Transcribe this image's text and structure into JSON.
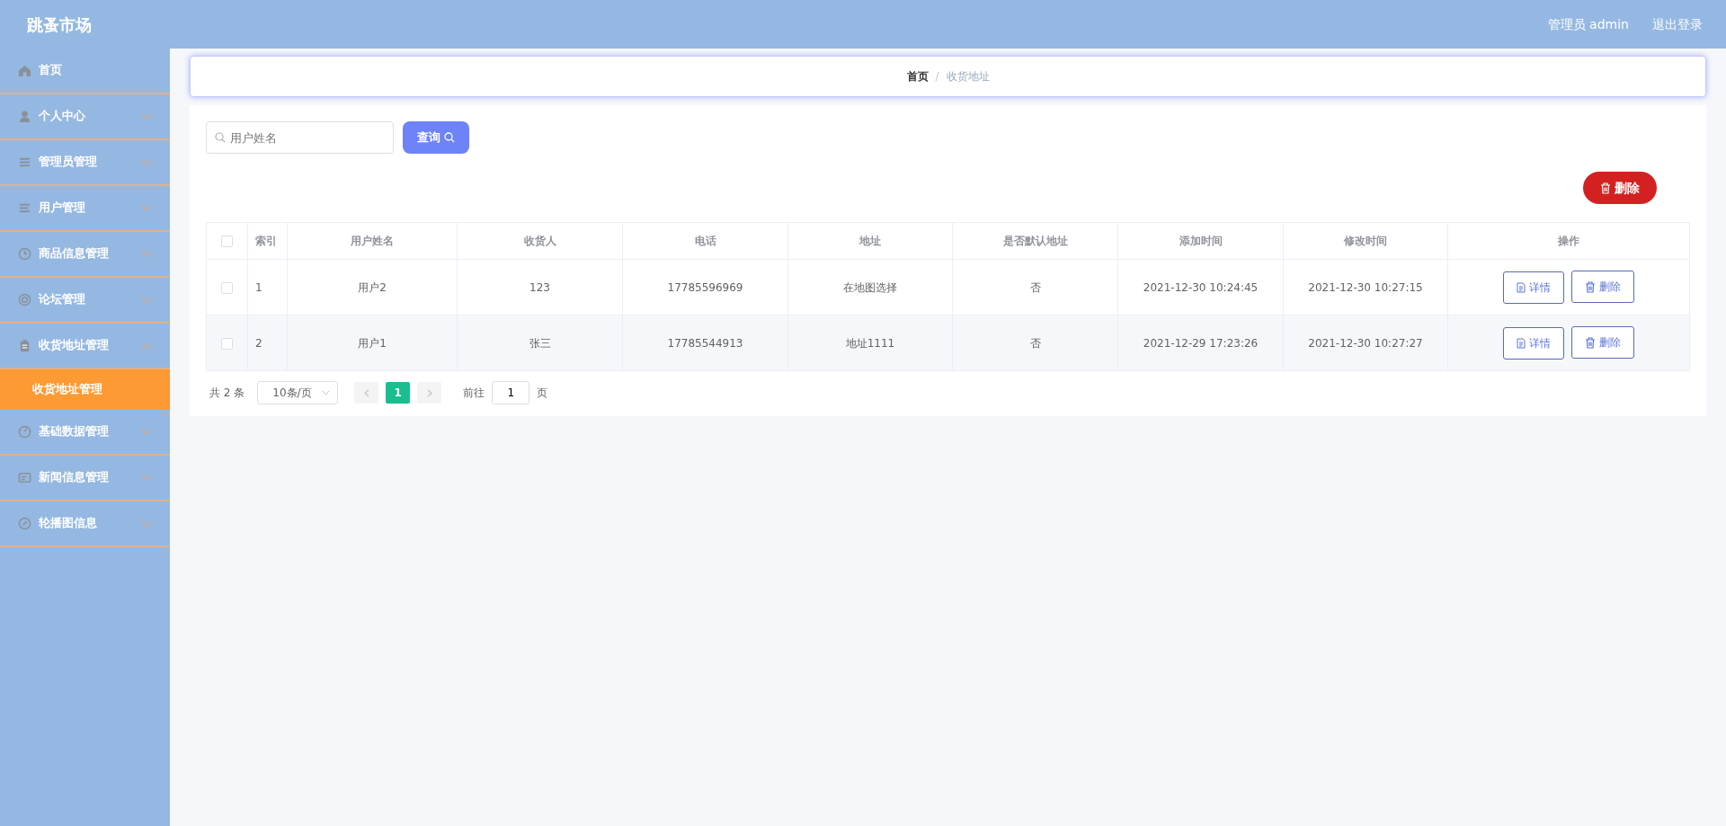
{
  "header": {
    "title": "跳蚤市场",
    "user": "管理员 admin",
    "logout": "退出登录"
  },
  "sidebar": {
    "items": [
      {
        "label": "首页",
        "expandable": false
      },
      {
        "label": "个人中心",
        "expandable": true,
        "expanded": false
      },
      {
        "label": "管理员管理",
        "expandable": true,
        "expanded": false
      },
      {
        "label": "用户管理",
        "expandable": true,
        "expanded": false
      },
      {
        "label": "商品信息管理",
        "expandable": true,
        "expanded": false
      },
      {
        "label": "论坛管理",
        "expandable": true,
        "expanded": false
      },
      {
        "label": "收货地址管理",
        "expandable": true,
        "expanded": true,
        "children": [
          {
            "label": "收货地址管理",
            "selected": true
          }
        ]
      },
      {
        "label": "基础数据管理",
        "expandable": true,
        "expanded": false
      },
      {
        "label": "新闻信息管理",
        "expandable": true,
        "expanded": false
      },
      {
        "label": "轮播图信息",
        "expandable": true,
        "expanded": false
      }
    ]
  },
  "breadcrumb": {
    "separator": "/",
    "items": [
      {
        "label": "首页",
        "selected": false
      },
      {
        "label": "收货地址",
        "selected": true
      }
    ]
  },
  "search": {
    "placeholder": "用户姓名",
    "button": "查询"
  },
  "delete_button": "删除",
  "table": {
    "all_checked": false,
    "columns": [
      "索引",
      "用户姓名",
      "收货人",
      "电话",
      "地址",
      "是否默认地址",
      "添加时间",
      "修改时间",
      "操作"
    ],
    "rows": [
      {
        "checked": false,
        "cells": [
          "1",
          "用户2",
          "123",
          "17785596969",
          "在地图选择",
          "否",
          "2021-12-30 10:24:45",
          "2021-12-30 10:27:15"
        ],
        "actions": [
          "详情",
          "删除"
        ]
      },
      {
        "checked": false,
        "cells": [
          "2",
          "用户1",
          "张三",
          "17785544913",
          "地址1111",
          "否",
          "2021-12-29 17:23:26",
          "2021-12-30 10:27:27"
        ],
        "actions": [
          "详情",
          "删除"
        ]
      }
    ]
  },
  "pagination": {
    "total": "共 2 条",
    "page_size": "10条/页",
    "pages": [
      {
        "label": "1",
        "selected": true
      }
    ],
    "goto_label": "前往",
    "goto_value": "1",
    "goto_suffix": "页"
  }
}
